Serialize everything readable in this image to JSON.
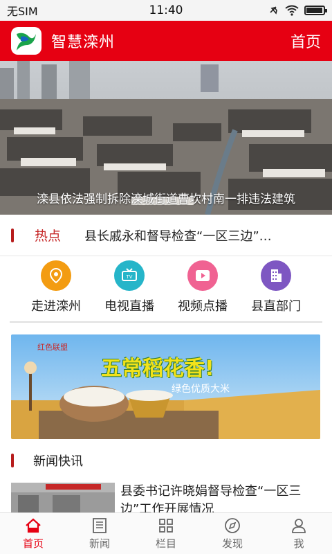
{
  "status_bar": {
    "carrier": "无SIM",
    "time": "11:40"
  },
  "header": {
    "app_title": "智慧滦州",
    "home_link": "首页",
    "logo_icon": "app-logo-icon"
  },
  "banner": {
    "caption": "滦县依法强制拆除滦城街道曹坎村南一排违法建筑"
  },
  "hot": {
    "label": "热点",
    "headline": "县长戚永和督导检查“一区三边”…"
  },
  "quick_links": [
    {
      "label": "走进滦州",
      "icon": "location-pin-icon",
      "color": "#f39c12"
    },
    {
      "label": "电视直播",
      "icon": "tv-icon",
      "color": "#26b5c9"
    },
    {
      "label": "视频点播",
      "icon": "play-icon",
      "color": "#f06292"
    },
    {
      "label": "县直部门",
      "icon": "building-icon",
      "color": "#7e57c2"
    }
  ],
  "ad": {
    "brand": "红色联盟",
    "slogan": "五常稻花香!",
    "subtitle": "绿色优质大米"
  },
  "news": {
    "section_title": "新闻快讯",
    "items": [
      {
        "title": "县委书记许晓娟督导检查“一区三边”工作开展情况"
      }
    ]
  },
  "tab_bar": {
    "tabs": [
      {
        "label": "首页",
        "icon": "home-icon",
        "active": true
      },
      {
        "label": "新闻",
        "icon": "news-icon",
        "active": false
      },
      {
        "label": "栏目",
        "icon": "grid-icon",
        "active": false
      },
      {
        "label": "发现",
        "icon": "compass-icon",
        "active": false
      },
      {
        "label": "我",
        "icon": "user-icon",
        "active": false
      }
    ]
  },
  "colors": {
    "brand_red": "#e60012",
    "accent_dark_red": "#b71c1c"
  }
}
